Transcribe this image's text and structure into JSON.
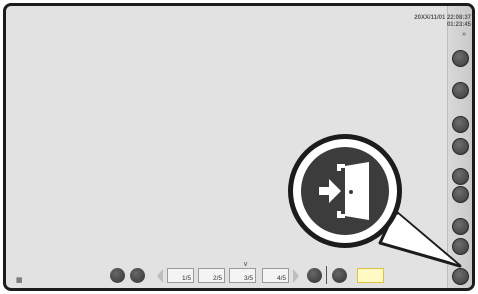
{
  "status": {
    "date": "20XX/11/01 22:08:37",
    "elapsed": "01:23:45"
  },
  "top_chevron_icon": "double-chevron-right-icon",
  "bottom": {
    "up_icon": "double-chevron-down-icon",
    "page_tabs": [
      "1/5",
      "2/5",
      "3/5",
      "4/5"
    ]
  },
  "callout": {
    "icon": "exit-door-icon"
  },
  "colors": {
    "frame": "#1c1c1c",
    "screen_bg": "#e2e2e2",
    "button_dark": "#3a3a3a",
    "highlight_yellow": "#fff9c4"
  }
}
